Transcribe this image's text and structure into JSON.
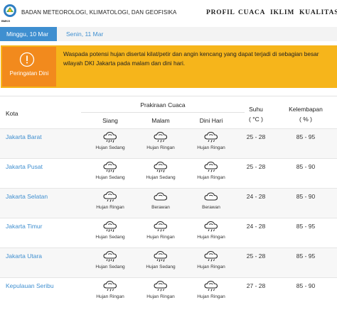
{
  "header": {
    "org_name": "BADAN METEOROLOGI, KLIMATOLOGI, DAN GEOFISIKA",
    "logo_text": "BMKG",
    "nav": [
      "PROFIL",
      "CUACA",
      "IKLIM",
      "KUALITAS U"
    ]
  },
  "dates": {
    "active": "Minggu, 10 Mar",
    "next": "Senin, 11 Mar"
  },
  "warning": {
    "label": "Peringatan Dini",
    "text": "Waspada potensi hujan disertai kilat/petir dan angin kencang yang dapat terjadi di sebagian besar wilayah DKI Jakarta pada malam dan dini hari."
  },
  "table": {
    "headers": {
      "city": "Kota",
      "forecast": "Prakiraan Cuaca",
      "siang": "Siang",
      "malam": "Malam",
      "dini_hari": "Dini Hari",
      "temp": "Suhu",
      "temp_unit": "( °C )",
      "humidity": "Kelembapan",
      "humidity_unit": "( % )"
    },
    "rows": [
      {
        "city": "Jakarta Barat",
        "siang": "Hujan Sedang",
        "malam": "Hujan Ringan",
        "dini_hari": "Hujan Ringan",
        "temp": "25 - 28",
        "humidity": "85 - 95"
      },
      {
        "city": "Jakarta Pusat",
        "siang": "Hujan Sedang",
        "malam": "Hujan Sedang",
        "dini_hari": "Hujan Ringan",
        "temp": "25 - 28",
        "humidity": "85 - 90"
      },
      {
        "city": "Jakarta Selatan",
        "siang": "Hujan Ringan",
        "malam": "Berawan",
        "dini_hari": "Berawan",
        "temp": "24 - 28",
        "humidity": "85 - 90"
      },
      {
        "city": "Jakarta Timur",
        "siang": "Hujan Sedang",
        "malam": "Hujan Ringan",
        "dini_hari": "Hujan Ringan",
        "temp": "24 - 28",
        "humidity": "85 - 95"
      },
      {
        "city": "Jakarta Utara",
        "siang": "Hujan Sedang",
        "malam": "Hujan Sedang",
        "dini_hari": "Hujan Ringan",
        "temp": "25 - 28",
        "humidity": "85 - 95"
      },
      {
        "city": "Kepulauan Seribu",
        "siang": "Hujan Ringan",
        "malam": "Hujan Ringan",
        "dini_hari": "Hujan Ringan",
        "temp": "27 - 28",
        "humidity": "85 - 90"
      }
    ]
  },
  "colors": {
    "link": "#3f8fd0",
    "warning_bg": "#f6b51b",
    "warning_side": "#f28a1d",
    "date_active": "#3f8fd0"
  }
}
